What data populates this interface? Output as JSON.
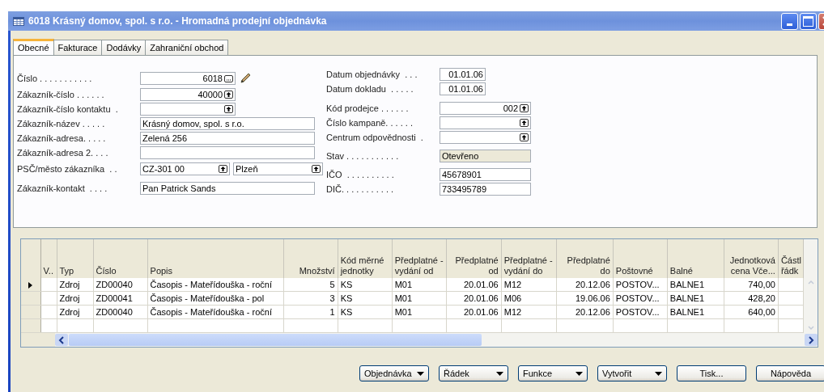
{
  "window": {
    "title": "6018 Krásný domov, spol. s r.o. - Hromadná prodejní objednávka"
  },
  "tabs": [
    {
      "label": "Obecné",
      "selected": true
    },
    {
      "label": "Fakturace",
      "selected": false
    },
    {
      "label": "Dodávky",
      "selected": false
    },
    {
      "label": "Zahraniční obchod",
      "selected": false
    }
  ],
  "left_fields": [
    {
      "label": "Číslo . . . . . . . . . . .",
      "inputs": [
        {
          "kind": "assist",
          "value": "6018"
        }
      ]
    },
    {
      "label": "Zákazník-číslo . . . . . .",
      "inputs": [
        {
          "kind": "lookup",
          "value": "40000"
        }
      ]
    },
    {
      "label": "Zákazník-číslo kontaktu  .",
      "inputs": [
        {
          "kind": "lookup"
        }
      ]
    },
    {
      "label": "Zákazník-název . . . . .",
      "inputs": [
        {
          "kind": "text",
          "value": "Krásný domov, spol. s r.o."
        }
      ]
    },
    {
      "label": "Zákazník-adresa. . . . .",
      "inputs": [
        {
          "kind": "text",
          "value": "Zelená 256"
        }
      ]
    },
    {
      "label": "Zákazník-adresa 2. . . .",
      "inputs": [
        {
          "kind": "text"
        }
      ]
    },
    {
      "label": "PSČ/město zákazníka  . .",
      "inputs": [
        {
          "kind": "combo",
          "value": "CZ-301 00"
        },
        {
          "kind": "combo",
          "value": "Plzeň"
        }
      ]
    },
    {
      "label": "Zákazník-kontakt  . . . .",
      "inputs": [
        {
          "kind": "text",
          "value": "Pan Patrick Sands"
        }
      ]
    }
  ],
  "right_fields": [
    {
      "label": "Datum objednávky  . . .",
      "inputs": [
        {
          "kind": "date",
          "value": "01.01.06"
        }
      ]
    },
    {
      "label": "Datum dokladu  . . . . .",
      "inputs": [
        {
          "kind": "date",
          "value": "01.01.06"
        }
      ]
    },
    {
      "label": "Kód prodejce . . . . . .",
      "inputs": [
        {
          "kind": "lookup",
          "value": "002"
        }
      ]
    },
    {
      "label": "Číslo kampaně. . . . . .",
      "inputs": [
        {
          "kind": "lookup"
        }
      ]
    },
    {
      "label": "Centrum odpovědnosti  .",
      "inputs": [
        {
          "kind": "lookup"
        }
      ]
    },
    {
      "label": "Stav . . . . . . . . . . .",
      "inputs": [
        {
          "kind": "readonly",
          "value": "Otevřeno"
        }
      ]
    },
    {
      "label": "IČO  . . . . . . . . . .",
      "inputs": [
        {
          "kind": "short",
          "value": "45678901"
        }
      ]
    },
    {
      "label": "DIČ. . . . . . . . . . .",
      "inputs": [
        {
          "kind": "short",
          "value": "733495789"
        }
      ]
    }
  ],
  "table": {
    "columns": [
      {
        "label": "V..",
        "kind": "text"
      },
      {
        "label": "Typ",
        "kind": "text"
      },
      {
        "label": "Číslo",
        "kind": "text"
      },
      {
        "label": "Popis",
        "kind": "text"
      },
      {
        "label": "Množství",
        "kind": "number"
      },
      {
        "label": "Kód měrné jednotky",
        "kind": "text"
      },
      {
        "label": "Předplatné - vydání od",
        "kind": "text"
      },
      {
        "label": "Předplatné od",
        "kind": "number"
      },
      {
        "label": "Předplatné - vydání do",
        "kind": "text"
      },
      {
        "label": "Předplatné do",
        "kind": "number"
      },
      {
        "label": "Poštovné",
        "kind": "text"
      },
      {
        "label": "Balné",
        "kind": "text"
      },
      {
        "label": "Jednotková cena Vče...",
        "kind": "number"
      },
      {
        "label": "Částl řádk",
        "kind": "text"
      }
    ],
    "rows": [
      {
        "selected": true,
        "cells": [
          null,
          "Zdroj",
          "ZD00040",
          "Časopis - Mateřídouška - roční",
          "5",
          "KS",
          "M01",
          "20.01.06",
          "M12",
          "20.12.06",
          "POSTOV...",
          "BALNE1",
          "740,00",
          null
        ]
      },
      {
        "selected": false,
        "cells": [
          null,
          "Zdroj",
          "ZD00041",
          "Časopis - Mateřídouška - pol",
          "3",
          "KS",
          "M01",
          "20.01.06",
          "M06",
          "19.06.06",
          "POSTOV...",
          "BALNE1",
          "428,20",
          null
        ]
      },
      {
        "selected": false,
        "cells": [
          null,
          "Zdroj",
          "ZD00040",
          "Časopis - Mateřídouška - roční",
          "1",
          "KS",
          "M01",
          "20.01.06",
          "M12",
          "20.12.06",
          "POSTOV...",
          "BALNE1",
          "640,00",
          null
        ]
      }
    ]
  },
  "buttons": [
    {
      "label": "Objednávka",
      "kind": "menu"
    },
    {
      "label": "Řádek",
      "kind": "menu"
    },
    {
      "label": "Funkce",
      "kind": "menu"
    },
    {
      "label": "Vytvořit",
      "kind": "menu"
    },
    {
      "label": "Tisk...",
      "kind": "plain"
    },
    {
      "label": "Nápověda",
      "kind": "plain"
    }
  ]
}
